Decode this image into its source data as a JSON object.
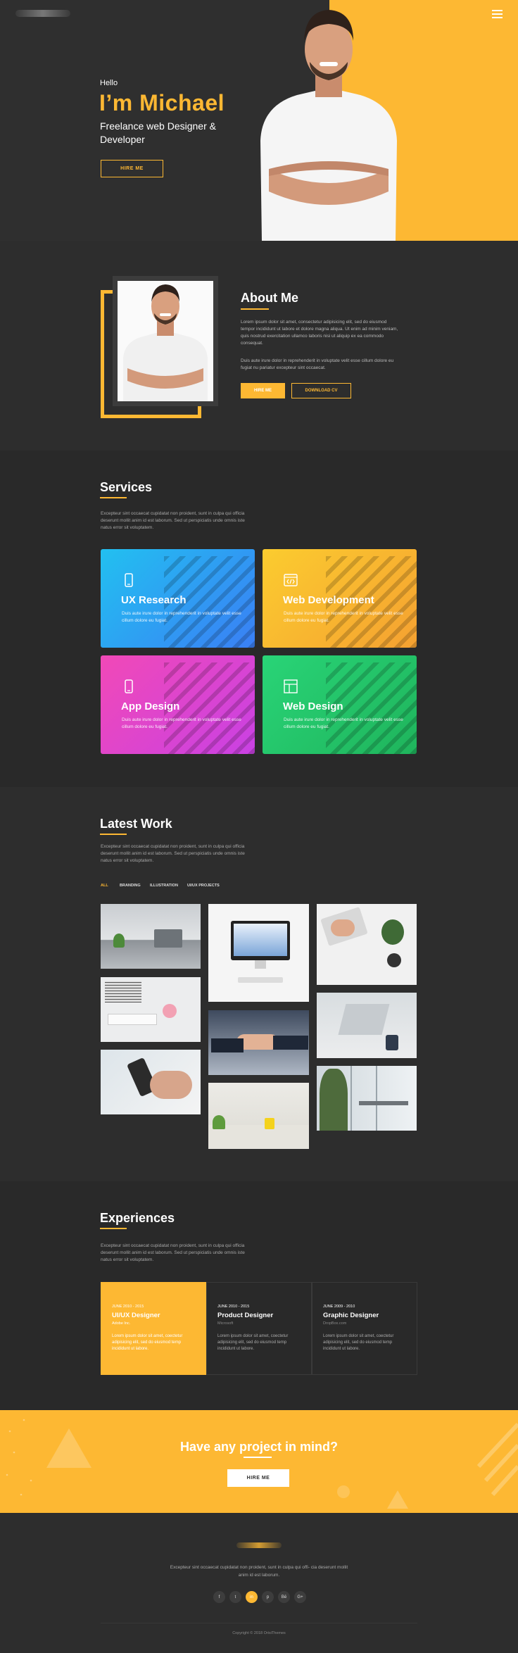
{
  "hero": {
    "greeting": "Hello",
    "name": "I’m Michael",
    "subtitle": "Freelance web Designer & Developer",
    "hire_label": "HIRE ME"
  },
  "about": {
    "title": "About Me",
    "para1": "Lorem ipsum dolor sit amet, consectetur adipisicing elit, sed do eiusmod tempor incididunt ut labore et dolore magna aliqua. Ut enim ad minim veniam, quis nostrud exercitation ullamco laboris nisi ut aliquip ex ea commodo consequat.",
    "para2": "Duis aute irure dolor in reprehenderit in voluptate velit esse cillum dolore eu fugiat nu pariatur excepteur sint occaecat.",
    "hire_label": "HIRE ME",
    "cv_label": "DOWNLOAD CV"
  },
  "services": {
    "title": "Services",
    "desc": "Excepteur sint occaecat cupidatat non proident, sunt in culpa qui officia deserunt mollit anim id est laborum. Sed ut perspiciatis unde omnis iste natus error sit voluptatem.",
    "cards": [
      {
        "title": "UX Research",
        "text": "Duis aute irure dolor in reprehenderit in voluptate velit esse cillum dolore eu fugiat.",
        "icon": "mobile-icon",
        "color": "#2aa8f7"
      },
      {
        "title": "Web Development",
        "text": "Duis aute irure dolor in reprehenderit in voluptate velit esse cillum dolore eu fugiat.",
        "icon": "code-window-icon",
        "color": "#f8b52f"
      },
      {
        "title": "App Design",
        "text": "Duis aute irure dolor in reprehenderit in voluptate velit esse cillum dolore eu fugiat.",
        "icon": "mobile-icon",
        "color": "#e640c6"
      },
      {
        "title": "Web Design",
        "text": "Duis aute irure dolor in reprehenderit in voluptate velit esse cillum dolore eu fugiat.",
        "icon": "layout-icon",
        "color": "#26c96b"
      }
    ]
  },
  "work": {
    "title": "Latest Work",
    "desc": "Excepteur sint occaecat cupidatat non proident, sunt in culpa qui officia deserunt mollit anim id est laborum. Sed ut perspiciatis unde omnis iste natus error sit voluptatem.",
    "filters": [
      "ALL",
      "BRANDING",
      "ILLUSTRATION",
      "UI/UX PROJECTS"
    ]
  },
  "experiences": {
    "title": "Experiences",
    "desc": "Excepteur sint occaecat cupidatat non proident, sunt in culpa qui officia deserunt mollit anim id est laborum. Sed ut perspiciatis unde omnis iste natus error sit voluptatem.",
    "items": [
      {
        "date": "JUNE 2010 - 2015",
        "role": "UI/UX Designer",
        "company": "Adobe Inc.",
        "desc": "Lorem ipsum dolor sit amet, coectetur adipisicing elit, sed do eiusmod temp incididunt ut labore."
      },
      {
        "date": "JUNE 2010 - 2015",
        "role": "Product Designer",
        "company": "Microsoft",
        "desc": "Lorem ipsum dolor sit amet, coectetur adipisicing elit, sed do eiusmod temp incididunt ut labore."
      },
      {
        "date": "JUNE 2009 - 2010",
        "role": "Graphic Designer",
        "company": "DropBox.com",
        "desc": "Lorem ipsum dolor sit amet, coectetur adipisicing elit, sed do eiusmod temp incididunt ut labore."
      }
    ]
  },
  "cta": {
    "title": "Have any project in mind?",
    "button_label": "HIRE ME"
  },
  "footer": {
    "text": "Excepteur sint occaecat cupidatat non proident, sunt in culpa qui offi- cia deserunt mollit anim id est laborum.",
    "social": [
      "f",
      "t",
      "in",
      "p",
      "Bē",
      "G+"
    ],
    "copyright": "Copyright © 2018 OrisiThemes"
  },
  "colors": {
    "accent": "#fdb833",
    "dark": "#2d2d2d"
  }
}
